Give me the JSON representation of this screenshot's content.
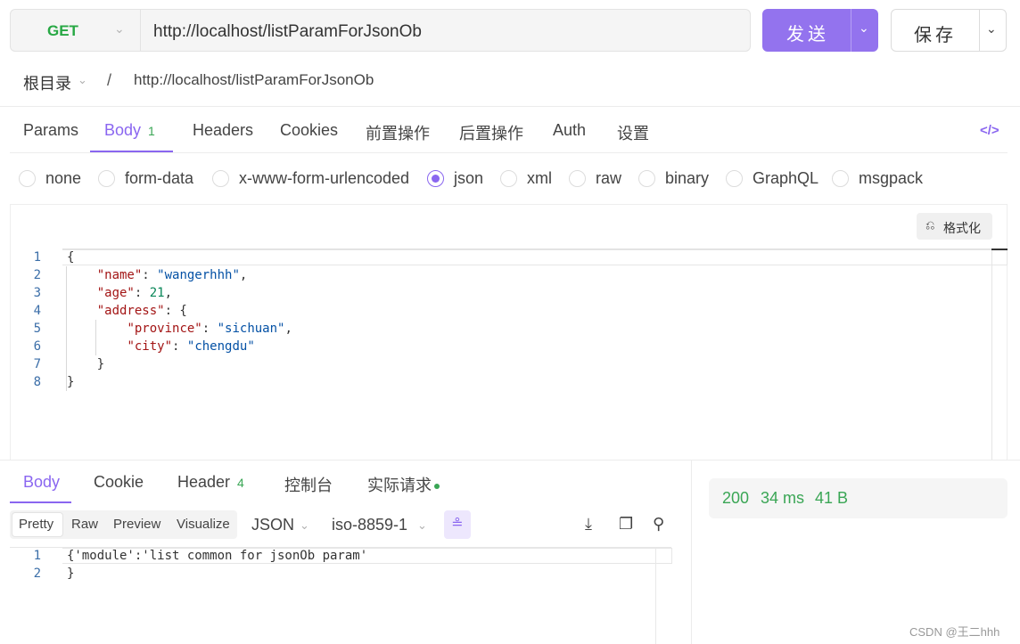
{
  "request": {
    "method": "GET",
    "url": "http://localhost/listParamForJsonOb",
    "send_label": "发送",
    "save_label": "保存"
  },
  "breadcrumb": {
    "root": "根目录",
    "separator": "/",
    "path": "http://localhost/listParamForJsonOb"
  },
  "tabs": [
    {
      "label": "Params"
    },
    {
      "label": "Body",
      "badge": "1",
      "active": true
    },
    {
      "label": "Headers"
    },
    {
      "label": "Cookies"
    },
    {
      "label": "前置操作"
    },
    {
      "label": "后置操作"
    },
    {
      "label": "Auth"
    },
    {
      "label": "设置"
    }
  ],
  "body_types": [
    {
      "label": "none"
    },
    {
      "label": "form-data"
    },
    {
      "label": "x-www-form-urlencoded"
    },
    {
      "label": "json",
      "checked": true
    },
    {
      "label": "xml"
    },
    {
      "label": "raw"
    },
    {
      "label": "binary"
    },
    {
      "label": "GraphQL"
    },
    {
      "label": "msgpack"
    }
  ],
  "editor": {
    "format_label": "格式化",
    "line_numbers": [
      "1",
      "2",
      "3",
      "4",
      "5",
      "6",
      "7",
      "8"
    ],
    "json": {
      "name": "wangerhhh",
      "age": "21",
      "province": "sichuan",
      "city": "chengdu"
    }
  },
  "response": {
    "tabs": [
      {
        "label": "Body",
        "active": true
      },
      {
        "label": "Cookie"
      },
      {
        "label": "Header",
        "badge": "4"
      },
      {
        "label": "控制台"
      },
      {
        "label": "实际请求"
      }
    ],
    "view_modes": [
      "Pretty",
      "Raw",
      "Preview",
      "Visualize"
    ],
    "active_view": "Pretty",
    "format": "JSON",
    "encoding": "iso-8859-1",
    "line_numbers": [
      "1",
      "2"
    ],
    "lines": [
      "{'module':'list common for jsonOb param'",
      "}"
    ],
    "status": "200",
    "time": "34 ms",
    "size": "41 B"
  },
  "watermark": "CSDN @王二hhh",
  "colors": {
    "accent": "#9373ee",
    "success": "#3aa655",
    "method_get": "#27a844"
  }
}
